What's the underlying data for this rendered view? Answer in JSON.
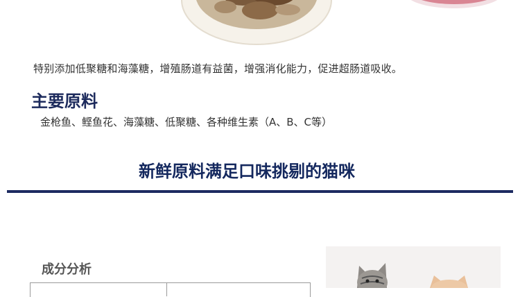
{
  "description": "特别添加低聚糖和海藻糖，增殖肠道有益菌，增强消化能力，促进超肠道吸收。",
  "ingredients_section": {
    "title": "主要原料",
    "text": "金枪鱼、鲣鱼花、海藻糖、低聚糖、各种维生素（A、B、C等）"
  },
  "headline": "新鲜原料满足口味挑剔的猫咪",
  "analysis_section": {
    "title": "成分分析"
  },
  "colors": {
    "heading": "#1c2a5c",
    "rule": "#1d2b61",
    "tin_pink": "#d98593"
  },
  "images": [
    "food-plate-image",
    "pink-can-image",
    "kittens-image"
  ]
}
